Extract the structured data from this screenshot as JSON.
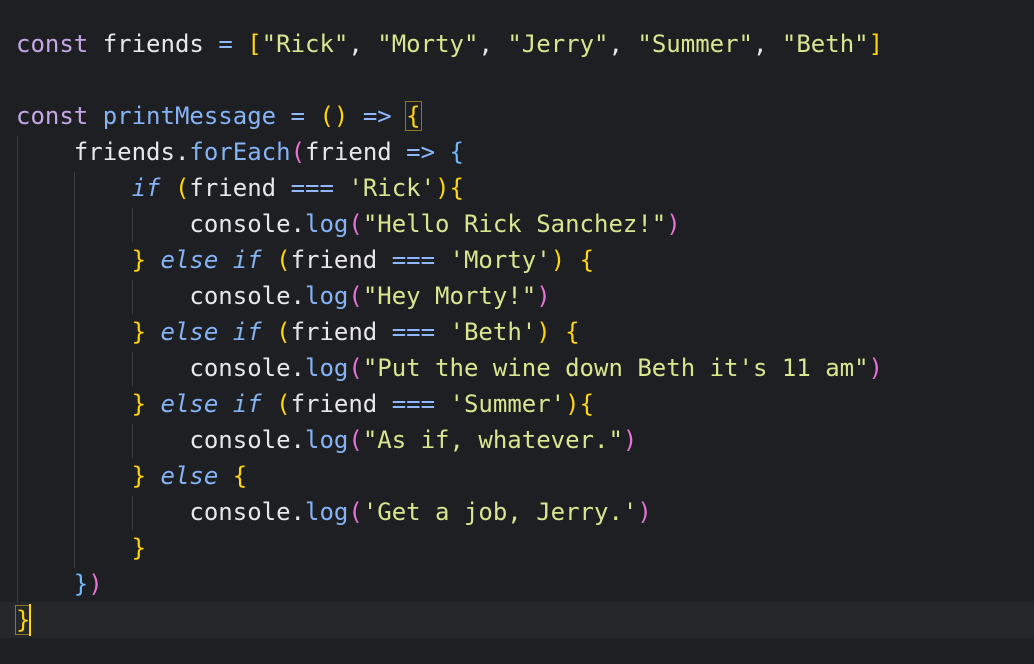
{
  "code": {
    "l1": {
      "kw": "const",
      "name": "friends",
      "eq": "=",
      "open": "[",
      "s1": "\"Rick\"",
      "s2": "\"Morty\"",
      "s3": "\"Jerry\"",
      "s4": "\"Summer\"",
      "s5": "\"Beth\"",
      "close": "]"
    },
    "l3": {
      "kw": "const",
      "name": "printMessage",
      "eq": "=",
      "paren": "()",
      "arrow": "=>",
      "brace": "{"
    },
    "l4": {
      "obj": "friends",
      "dot": ".",
      "method": "forEach",
      "open": "(",
      "arg": "friend",
      "arrow": "=>",
      "brace": "{"
    },
    "l5": {
      "kw": "if",
      "open": "(",
      "arg": "friend",
      "op": "===",
      "str": "'Rick'",
      "close": ")",
      "brace": "{"
    },
    "l6": {
      "obj": "console",
      "dot": ".",
      "method": "log",
      "open": "(",
      "str": "\"Hello Rick Sanchez!\"",
      "close": ")"
    },
    "l7": {
      "brace": "}",
      "kw": "else if",
      "open": "(",
      "arg": "friend",
      "op": "===",
      "str": "'Morty'",
      "close": ")",
      "brace2": "{"
    },
    "l8": {
      "obj": "console",
      "dot": ".",
      "method": "log",
      "open": "(",
      "str": "\"Hey Morty!\"",
      "close": ")"
    },
    "l9": {
      "brace": "}",
      "kw": "else if",
      "open": "(",
      "arg": "friend",
      "op": "===",
      "str": "'Beth'",
      "close": ")",
      "brace2": "{"
    },
    "l10": {
      "obj": "console",
      "dot": ".",
      "method": "log",
      "open": "(",
      "str": "\"Put the wine down Beth it's 11 am\"",
      "close": ")"
    },
    "l11": {
      "brace": "}",
      "kw": "else if",
      "open": "(",
      "arg": "friend",
      "op": "===",
      "str": "'Summer'",
      "close": ")",
      "brace2": "{"
    },
    "l12": {
      "obj": "console",
      "dot": ".",
      "method": "log",
      "open": "(",
      "str": "\"As if, whatever.\"",
      "close": ")"
    },
    "l13": {
      "brace": "}",
      "kw": "else",
      "brace2": "{"
    },
    "l14": {
      "obj": "console",
      "dot": ".",
      "method": "log",
      "open": "(",
      "str": "'Get a job, Jerry.'",
      "close": ")"
    },
    "l15": {
      "brace": "}"
    },
    "l16": {
      "brace": "}",
      "paren": ")"
    },
    "l17": {
      "brace": "}"
    }
  },
  "colors": {
    "background": "#1e1f22",
    "keyword": "#c4a7e7",
    "function": "#85b3f6",
    "string": "#d9e58f",
    "bracket_level1": "#ffd60a",
    "bracket_level2": "#e873d8",
    "bracket_level3": "#6fb9ff"
  }
}
